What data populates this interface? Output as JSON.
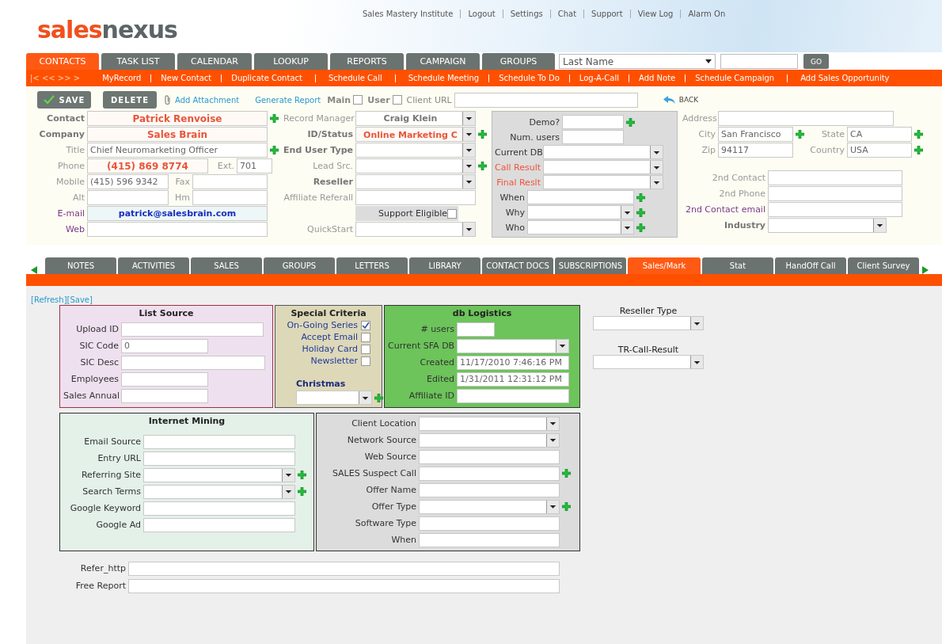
{
  "header": {
    "logo": {
      "first": "sales",
      "second": "nexus"
    },
    "links": [
      "Sales Mastery Institute",
      "Logout",
      "Settings",
      "Chat",
      "Support",
      "View Log",
      "Alarm On"
    ]
  },
  "main_tabs": [
    {
      "label": "CONTACTS",
      "selected": true
    },
    {
      "label": "TASK LIST",
      "selected": false
    },
    {
      "label": "CALENDAR",
      "selected": false
    },
    {
      "label": "LOOKUP",
      "selected": false
    },
    {
      "label": "REPORTS",
      "selected": false
    },
    {
      "label": "CAMPAIGN",
      "selected": false
    },
    {
      "label": "GROUPS",
      "selected": false
    }
  ],
  "search": {
    "selector": "Last Name",
    "button": "GO"
  },
  "action_bar": {
    "nav": "|< << >> >",
    "links": [
      "MyRecord",
      "New Contact",
      "Duplicate Contact",
      "Schedule Call",
      "Schedule Meeting",
      "Schedule To Do",
      "Log-A-Call",
      "Add Note",
      "Schedule Campaign",
      "Add Sales Opportunity"
    ]
  },
  "toolbar": {
    "save": "SAVE",
    "delete": "DELETE",
    "attachment": "Add Attachment",
    "report": "Generate Report",
    "checks": [
      {
        "label": "Main",
        "checked": false
      },
      {
        "label": "User",
        "checked": false
      }
    ],
    "client_url_label": "Client URL",
    "back": "BACK"
  },
  "columns": [
    {
      "boxed": false,
      "groups": [
        [
          {
            "label": "Contact",
            "bold": true,
            "alert": false,
            "link": false,
            "kind": "text",
            "value": "Patrick Renvoise",
            "highlighted": true,
            "plus": true
          },
          {
            "label": "Company",
            "bold": true,
            "alert": false,
            "link": false,
            "kind": "text",
            "value": "Sales Brain",
            "highlighted": true,
            "plus": false
          },
          {
            "label": "Title",
            "bold": false,
            "alert": false,
            "link": false,
            "kind": "text",
            "value": "Chief Neuromarketing Officer",
            "highlighted": false,
            "plus": true
          },
          {
            "label": "Phone",
            "bold": false,
            "alert": false,
            "link": false,
            "kind": "text",
            "value": "(415) 869 8774",
            "highlighted": true,
            "plus": false,
            "extra": {
              "label": "Ext.",
              "value": "701"
            }
          },
          {
            "label": "Mobile",
            "bold": false,
            "alert": false,
            "link": false,
            "kind": "text",
            "value": "(415) 596 9342",
            "highlighted": false,
            "plus": false,
            "extra": {
              "label": "Fax"
            }
          },
          {
            "label": "Alt",
            "bold": false,
            "alert": false,
            "link": false,
            "kind": "text",
            "plus": false,
            "extra": {
              "label": "Hm"
            }
          },
          {
            "label": "E-mail",
            "bold": false,
            "alert": false,
            "link": true,
            "kind": "text",
            "value": "patrick@salesbrain.com",
            "highlighted": false,
            "plus": false
          },
          {
            "label": "Web",
            "bold": false,
            "alert": false,
            "link": true,
            "kind": "text",
            "plus": false
          }
        ]
      ]
    },
    {
      "boxed": false,
      "groups": [
        [
          {
            "label": "Record Manager",
            "bold": false,
            "alert": false,
            "link": false,
            "kind": "select",
            "value": "Craig Klein",
            "highlighted": false,
            "plus": false
          },
          {
            "label": "ID/Status",
            "bold": true,
            "alert": false,
            "link": false,
            "kind": "select",
            "value": "Online Marketing C",
            "highlighted": true,
            "plus": true
          },
          {
            "label": "End User Type",
            "bold": true,
            "alert": false,
            "link": false,
            "kind": "select",
            "plus": false
          },
          {
            "label": "Lead Src.",
            "bold": false,
            "alert": false,
            "link": false,
            "kind": "select",
            "plus": true
          },
          {
            "label": "Reseller",
            "bold": true,
            "alert": false,
            "link": false,
            "kind": "select",
            "plus": false
          },
          {
            "label": "Affiliate Referall",
            "bold": false,
            "alert": false,
            "link": false,
            "kind": "text",
            "plus": false
          },
          {
            "label": "Support Eligible",
            "bold": false,
            "alert": false,
            "link": false,
            "kind": "checkbox",
            "checked": false,
            "plus": false
          },
          {
            "label": "QuickStart",
            "bold": false,
            "alert": false,
            "link": false,
            "kind": "select",
            "plus": false
          }
        ]
      ]
    },
    {
      "boxed": true,
      "groups": [
        [
          {
            "label": "Demo?",
            "bold": false,
            "alert": false,
            "link": false,
            "kind": "text",
            "plus": true
          },
          {
            "label": "Num. users",
            "bold": false,
            "alert": false,
            "link": false,
            "kind": "text",
            "plus": false
          },
          {
            "label": "Current DB",
            "bold": false,
            "alert": false,
            "link": false,
            "kind": "select",
            "plus": false
          },
          {
            "label": "Call Result",
            "bold": false,
            "alert": true,
            "link": false,
            "kind": "select",
            "plus": false
          },
          {
            "label": "Final Reslt",
            "bold": false,
            "alert": true,
            "link": false,
            "kind": "select",
            "plus": false
          },
          {
            "label": "When",
            "bold": false,
            "alert": false,
            "link": false,
            "kind": "text",
            "plus": true
          },
          {
            "label": "Why",
            "bold": false,
            "alert": false,
            "link": false,
            "kind": "select",
            "plus": true
          },
          {
            "label": "Who",
            "bold": false,
            "alert": false,
            "link": false,
            "kind": "select",
            "plus": true
          }
        ]
      ]
    },
    {
      "boxed": false,
      "groups": [
        [
          {
            "label": "Address",
            "bold": false,
            "alert": false,
            "link": false,
            "kind": "text",
            "plus": false
          },
          {
            "label": "City",
            "bold": false,
            "alert": false,
            "link": false,
            "kind": "text",
            "value": "San Francisco",
            "highlighted": false,
            "plus": true,
            "extra": {
              "label": "State",
              "value": "CA",
              "plus": true
            }
          },
          {
            "label": "Zip",
            "bold": false,
            "alert": false,
            "link": false,
            "kind": "text",
            "value": "94117",
            "highlighted": false,
            "plus": false,
            "extra": {
              "label": "Country",
              "value": "USA",
              "plus": true
            }
          }
        ],
        [
          {
            "label": "2nd Contact",
            "bold": false,
            "alert": false,
            "link": false,
            "kind": "text",
            "plus": false
          },
          {
            "label": "2nd Phone",
            "bold": false,
            "alert": false,
            "link": false,
            "kind": "text",
            "plus": false
          },
          {
            "label": "2nd Contact email",
            "bold": false,
            "alert": false,
            "link": true,
            "kind": "text",
            "plus": false
          },
          {
            "label": "Industry",
            "bold": true,
            "alert": false,
            "link": false,
            "kind": "select",
            "plus": false
          }
        ]
      ]
    }
  ],
  "sub_tabs": [
    {
      "label": "NOTES",
      "selected": false
    },
    {
      "label": "ACTIVITIES",
      "selected": false
    },
    {
      "label": "SALES",
      "selected": false
    },
    {
      "label": "GROUPS",
      "selected": false
    },
    {
      "label": "LETTERS",
      "selected": false
    },
    {
      "label": "LIBRARY",
      "selected": false
    },
    {
      "label": "CONTACT DOCS",
      "selected": false
    },
    {
      "label": "SUBSCRIPTIONS",
      "selected": false
    },
    {
      "label": "Sales/Mark",
      "selected": true
    },
    {
      "label": "Stat",
      "selected": false
    },
    {
      "label": "HandOff Call",
      "selected": false
    },
    {
      "label": "Client Survey",
      "selected": false
    }
  ],
  "section_links": [
    "[Refresh]",
    "[Save]"
  ],
  "list_source": {
    "title": "List Source",
    "rows": [
      {
        "label": "Upload ID",
        "kind": "text"
      },
      {
        "label": "SIC Code",
        "kind": "text",
        "value": "0"
      },
      {
        "label": "SIC Desc",
        "kind": "text"
      },
      {
        "label": "Employees",
        "kind": "text"
      },
      {
        "label": "Sales Annual",
        "kind": "text"
      }
    ]
  },
  "special_criteria": {
    "title": "Special Criteria",
    "checks": [
      {
        "label": "On-Going Series",
        "checked": true
      },
      {
        "label": "Accept Email",
        "checked": false
      },
      {
        "label": "Holiday Card",
        "checked": false
      },
      {
        "label": "Newsletter",
        "checked": false
      }
    ],
    "select_label": "Christmas"
  },
  "db_logistics": {
    "title": "db Logistics",
    "rows": [
      {
        "label": "# users",
        "kind": "text"
      },
      {
        "label": "Current SFA DB",
        "kind": "select"
      },
      {
        "label": "Created",
        "kind": "text",
        "value": "11/17/2010 7:46:16 PM"
      },
      {
        "label": "Edited",
        "kind": "text",
        "value": "1/31/2011 12:31:12 PM"
      },
      {
        "label": "Affiliate ID",
        "kind": "text"
      }
    ]
  },
  "side_selects": [
    {
      "label": "Reseller Type"
    },
    {
      "label": "TR-Call-Result"
    }
  ],
  "internet_mining": {
    "title": "Internet Mining",
    "rows": [
      {
        "label": "Email Source",
        "kind": "text",
        "plus": false
      },
      {
        "label": "Entry URL",
        "kind": "text",
        "plus": false
      },
      {
        "label": "Referring Site",
        "kind": "select",
        "plus": true
      },
      {
        "label": "Search Terms",
        "kind": "select",
        "plus": true
      },
      {
        "label": "Google Keyword",
        "kind": "text",
        "plus": false
      },
      {
        "label": "Google Ad",
        "kind": "text",
        "plus": false
      }
    ]
  },
  "source_panel": {
    "rows": [
      {
        "label": "Client Location",
        "kind": "select",
        "plus": false
      },
      {
        "label": "Network Source",
        "kind": "select",
        "plus": false
      },
      {
        "label": "Web Source",
        "kind": "text",
        "plus": false
      },
      {
        "label": "SALES Suspect Call",
        "kind": "text",
        "plus": true
      },
      {
        "label": "Offer Name",
        "kind": "text",
        "plus": false
      },
      {
        "label": "Offer Type",
        "kind": "select",
        "plus": true
      },
      {
        "label": "Software Type",
        "kind": "text",
        "plus": false
      },
      {
        "label": "When",
        "kind": "text",
        "plus": false
      }
    ]
  },
  "bottom_rows": [
    {
      "label": "Refer_http",
      "kind": "text"
    },
    {
      "label": "Free Report",
      "kind": "text"
    }
  ]
}
